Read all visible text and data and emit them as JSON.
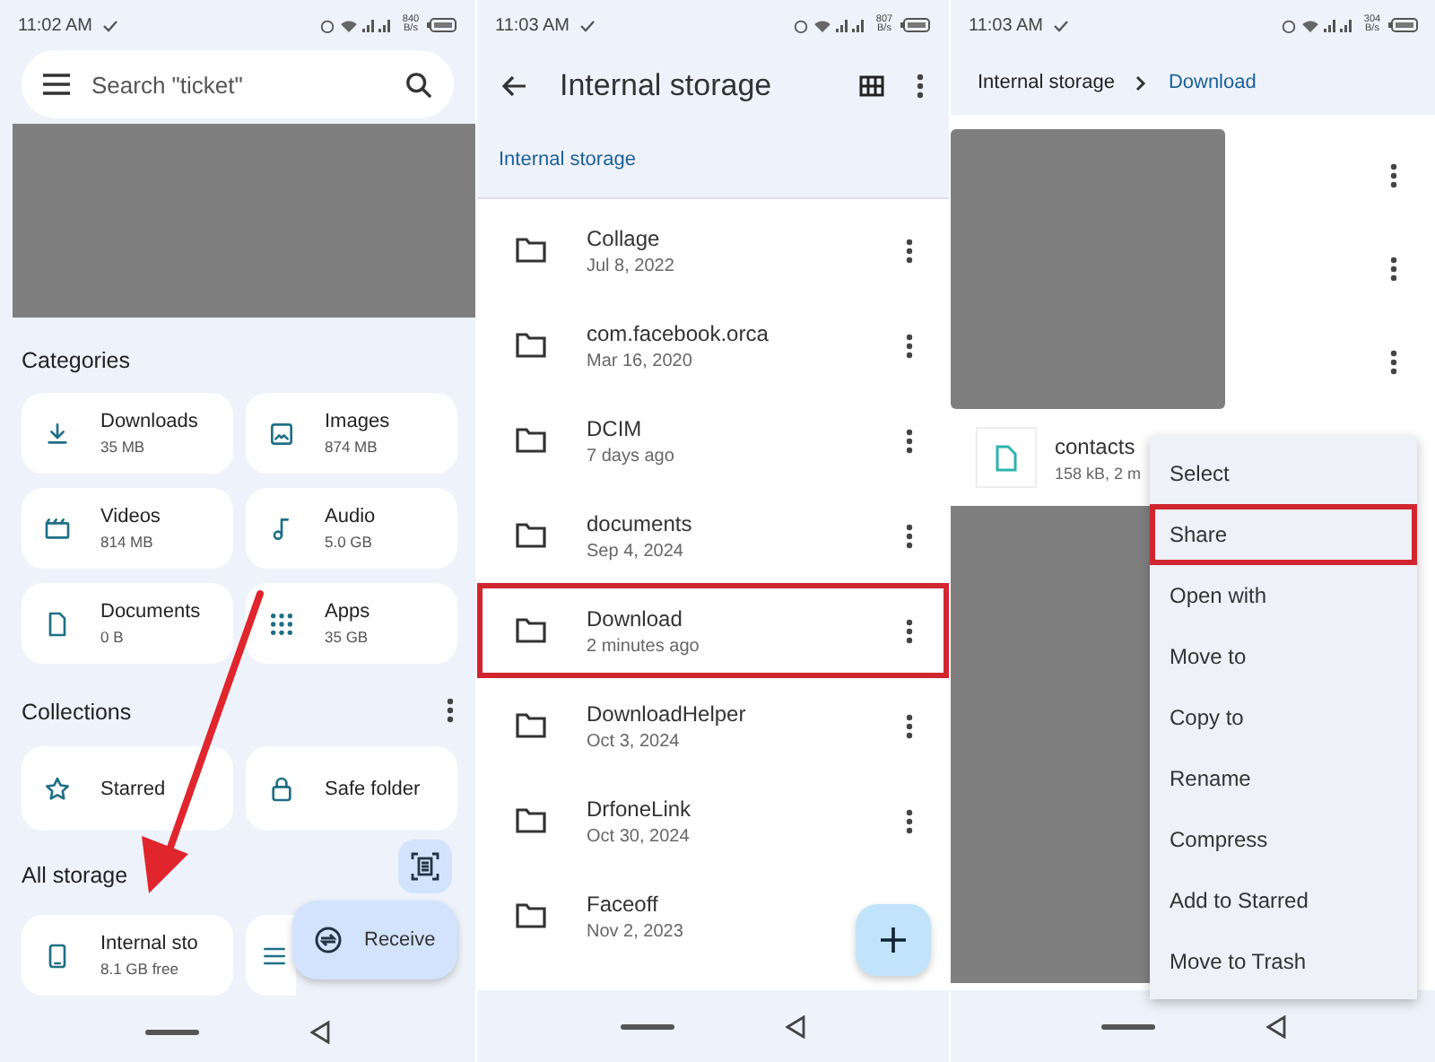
{
  "home_screen": {
    "status": {
      "time": "11:02 AM",
      "net_speed": "840 B/s"
    },
    "search": {
      "placeholder": "Search \"ticket\""
    },
    "categories": {
      "title": "Categories",
      "items": [
        {
          "name": "Downloads",
          "size": "35 MB",
          "kind": "downloads"
        },
        {
          "name": "Images",
          "size": "874 MB",
          "kind": "images"
        },
        {
          "name": "Videos",
          "size": "814 MB",
          "kind": "videos"
        },
        {
          "name": "Audio",
          "size": "5.0 GB",
          "kind": "audio"
        },
        {
          "name": "Documents",
          "size": "0 B",
          "kind": "documents"
        },
        {
          "name": "Apps",
          "size": "35 GB",
          "kind": "apps"
        }
      ]
    },
    "collections": {
      "title": "Collections",
      "items": [
        {
          "name": "Starred",
          "kind": "starred"
        },
        {
          "name": "Safe folder",
          "kind": "safe"
        }
      ]
    },
    "all_storage": {
      "title": "All storage",
      "items": [
        {
          "name": "Internal sto",
          "detail": "8.1 GB free",
          "kind": "phone"
        },
        {
          "kind": "other"
        }
      ]
    },
    "receive_button": {
      "label": "Receive"
    }
  },
  "folder_screen": {
    "status": {
      "time": "11:03 AM",
      "net_speed": "807 B/s"
    },
    "title": "Internal storage",
    "breadcrumb": "Internal storage",
    "folders": [
      {
        "name": "Collage",
        "modified": "Jul 8, 2022",
        "highlighted": false
      },
      {
        "name": "com.facebook.orca",
        "modified": "Mar 16, 2020",
        "highlighted": false
      },
      {
        "name": "DCIM",
        "modified": "7 days ago",
        "highlighted": false
      },
      {
        "name": "documents",
        "modified": "Sep 4, 2024",
        "highlighted": false
      },
      {
        "name": "Download",
        "modified": "2 minutes ago",
        "highlighted": true
      },
      {
        "name": "DownloadHelper",
        "modified": "Oct 3, 2024",
        "highlighted": false
      },
      {
        "name": "DrfoneLink",
        "modified": "Oct 30, 2024",
        "highlighted": false
      },
      {
        "name": "Faceoff",
        "modified": "Nov 2, 2023",
        "highlighted": false
      }
    ]
  },
  "download_screen": {
    "status": {
      "time": "11:03 AM",
      "net_speed": "304 B/s"
    },
    "breadcrumb": [
      "Internal storage",
      "Download"
    ],
    "file": {
      "name": "contacts",
      "detail": "158 kB, 2 m"
    },
    "menu": [
      {
        "label": "Select",
        "highlighted": false
      },
      {
        "label": "Share",
        "highlighted": true
      },
      {
        "label": "Open with",
        "highlighted": false
      },
      {
        "label": "Move to",
        "highlighted": false
      },
      {
        "label": "Copy to",
        "highlighted": false
      },
      {
        "label": "Rename",
        "highlighted": false
      },
      {
        "label": "Compress",
        "highlighted": false
      },
      {
        "label": "Add to Starred",
        "highlighted": false
      },
      {
        "label": "Move to Trash",
        "highlighted": false
      }
    ]
  }
}
